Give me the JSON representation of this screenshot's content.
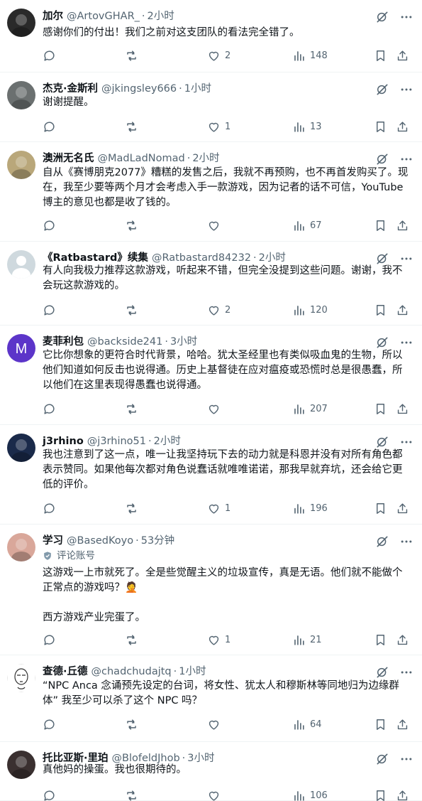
{
  "posts": [
    {
      "name": "加尔",
      "handle": "@ArtovGHAR_",
      "time": "2小时",
      "text": "感谢你们的付出！我们之前对这支团队的看法完全错了。",
      "replies": "",
      "reposts": "",
      "likes": "2",
      "views": "148",
      "avatar": {
        "type": "photo",
        "color": "#2a2a2a"
      }
    },
    {
      "name": "杰克·金斯利",
      "handle": "@jkingsley666",
      "time": "1小时",
      "text": "谢谢提醒。",
      "replies": "",
      "reposts": "",
      "likes": "1",
      "views": "13",
      "avatar": {
        "type": "photo",
        "color": "#6b7070"
      }
    },
    {
      "name": "澳洲无名氏",
      "handle": "@MadLadNomad",
      "time": "2小时",
      "text": "自从《赛博朋克2077》糟糕的发售之后，我就不再预购，也不再首发购买了。现在，我至少要等两个月才会考虑入手一款游戏，因为记者的话不可信，YouTube博主的意见也都是收了钱的。",
      "replies": "",
      "reposts": "",
      "likes": "",
      "views": "67",
      "avatar": {
        "type": "photo",
        "color": "#b9a77a"
      }
    },
    {
      "name": "《Ratbastard》续集",
      "handle": "@Ratbastard84232",
      "time": "2小时",
      "text": "有人向我极力推荐这款游戏，听起来不错，但完全没提到这些问题。谢谢，我不会玩这款游戏的。",
      "replies": "",
      "reposts": "",
      "likes": "2",
      "views": "120",
      "avatar": {
        "type": "default",
        "color": "#cfd9de"
      }
    },
    {
      "name": "麦菲利包",
      "handle": "@backside241",
      "time": "3小时",
      "text": "它比你想象的更符合时代背景，哈哈。犹太圣经里也有类似吸血鬼的生物，所以他们知道如何反击也说得通。历史上基督徒在应对瘟疫或恐慌时总是很愚蠢，所以他们在这里表现得愚蠢也说得通。",
      "replies": "",
      "reposts": "",
      "likes": "",
      "views": "207",
      "avatar": {
        "type": "letter",
        "letter": "M",
        "color": "#5c35c9"
      }
    },
    {
      "name": "j3rhino",
      "handle": "@j3rhino51",
      "time": "2小时",
      "text": "我也注意到了这一点，唯一让我坚持玩下去的动力就是科恩并没有对所有角色都表示赞同。如果他每次都对角色说蠢话就唯唯诺诺，那我早就弃坑，还会给它更低的评价。",
      "replies": "",
      "reposts": "",
      "likes": "1",
      "views": "196",
      "avatar": {
        "type": "photo",
        "color": "#1a2a4a"
      }
    },
    {
      "name": "学习",
      "handle": "@BasedKoyo",
      "time": "53分钟",
      "badge": "评论账号",
      "text": "这游戏一上市就死了。全是些觉醒主义的垃圾宣传，真是无语。他们就不能做个正常点的游戏吗？🤦\n\n西方游戏产业完蛋了。",
      "replies": "",
      "reposts": "",
      "likes": "1",
      "views": "21",
      "avatar": {
        "type": "photo",
        "color": "#d9a79a"
      }
    },
    {
      "name": "查德·丘德",
      "handle": "@chadchudajtq",
      "time": "1小时",
      "text": "“NPC Anca 念诵预先设定的台词，将女性、犹太人和穆斯林等同地归为边缘群体” 我至少可以杀了这个 NPC 吗？",
      "replies": "",
      "reposts": "",
      "likes": "",
      "views": "64",
      "avatar": {
        "type": "sketch",
        "color": "#ffffff"
      }
    },
    {
      "name": "托比亚斯·里珀",
      "handle": "@BlofeldJhob",
      "time": "3小时",
      "text": "真他妈的操蛋。我也很期待的。",
      "replies": "",
      "reposts": "",
      "likes": "",
      "views": "106",
      "avatar": {
        "type": "photo",
        "color": "#3a3030"
      }
    }
  ],
  "icons": {
    "reply": "reply-icon",
    "repost": "repost-icon",
    "like": "like-icon",
    "views": "views-icon",
    "bookmark": "bookmark-icon",
    "share": "share-icon",
    "grok": "grok-icon",
    "more": "more-icon"
  },
  "colors": {
    "text": "#0f1419",
    "secondary": "#536471",
    "divider": "#eff3f4"
  }
}
